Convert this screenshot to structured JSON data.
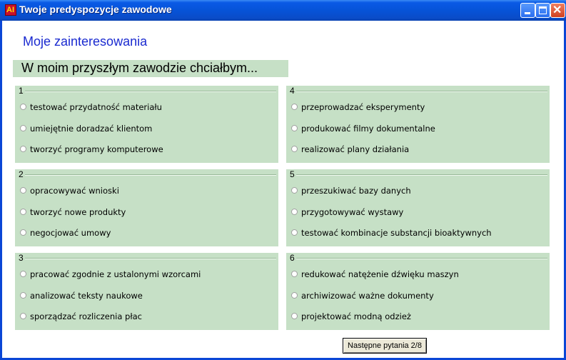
{
  "window": {
    "title": "Twoje predyspozycje zawodowe",
    "app_icon_text": "AI"
  },
  "heading": "Moje zainteresowania",
  "banner": "W moim przyszłym zawodzie chciałbym...",
  "groups": [
    {
      "number": "1",
      "options": [
        "testować przydatność materiału",
        "umiejętnie doradzać klientom",
        "tworzyć programy komputerowe"
      ]
    },
    {
      "number": "2",
      "options": [
        "opracowywać wnioski",
        "tworzyć nowe produkty",
        "negocjować umowy"
      ]
    },
    {
      "number": "3",
      "options": [
        "pracować zgodnie z ustalonymi wzorcami",
        "analizować teksty naukowe",
        "sporządzać rozliczenia płac"
      ]
    },
    {
      "number": "4",
      "options": [
        "przeprowadzać eksperymenty",
        "produkować filmy dokumentalne",
        "realizować plany działania"
      ]
    },
    {
      "number": "5",
      "options": [
        "przeszukiwać bazy danych",
        "przygotowywać wystawy",
        "testować kombinacje substancji bioaktywnych"
      ]
    },
    {
      "number": "6",
      "options": [
        "redukować natężenie dźwięku maszyn",
        "archiwizować ważne dokumenty",
        "projektować modną odzież"
      ]
    }
  ],
  "next_button": "Następne pytania 2/8",
  "colors": {
    "titlebar": "#0653d8",
    "panel": "#c6e0c6",
    "heading": "#1a2ad0"
  }
}
